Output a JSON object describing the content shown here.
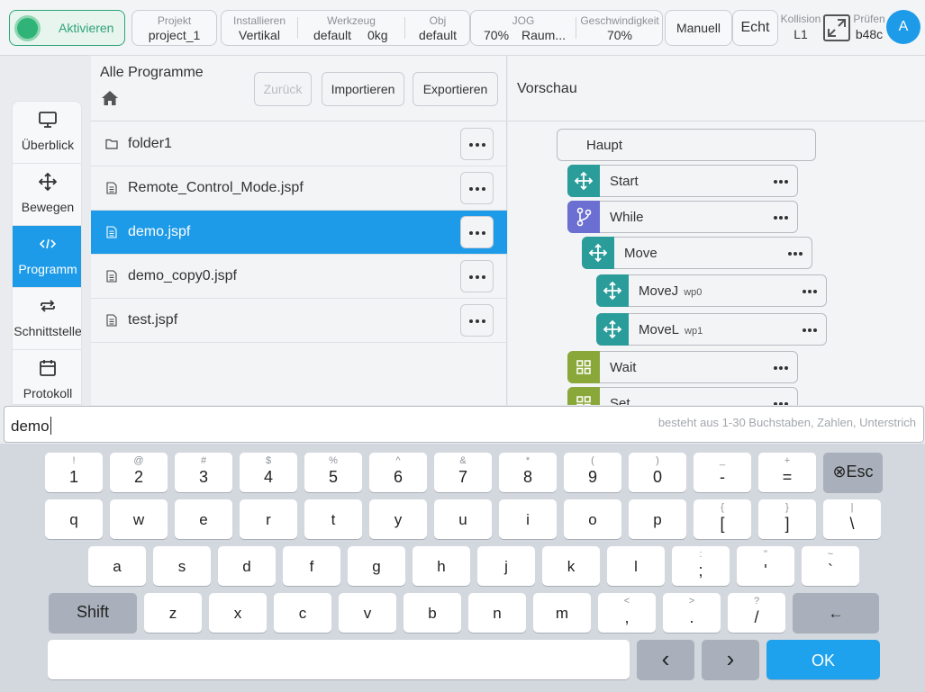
{
  "topbar": {
    "activate": "Aktivieren",
    "project": {
      "label": "Projekt",
      "value": "project_1"
    },
    "install": {
      "label": "Installieren",
      "value": "Vertikal"
    },
    "tool": {
      "label": "Werkzeug",
      "value": "default",
      "weight": "0kg"
    },
    "obj": {
      "label": "Obj",
      "value": "default"
    },
    "jog": {
      "label": "JOG",
      "value": "70%",
      "extra": "Raum..."
    },
    "speed": {
      "label": "Geschwindigkeit",
      "value": "70%"
    },
    "manual": "Manuell",
    "real": "Echt",
    "collision": {
      "label": "Kollision",
      "value": "L1"
    },
    "check": {
      "label": "Prüfen",
      "value": "b48c"
    },
    "avatar": "A"
  },
  "nav": {
    "items": [
      {
        "label": "Überblick",
        "icon": "monitor-icon"
      },
      {
        "label": "Bewegen",
        "icon": "move-icon"
      },
      {
        "label": "Programm",
        "icon": "code-icon",
        "active": true
      },
      {
        "label": "Schnittstelle",
        "icon": "swap-icon"
      },
      {
        "label": "Protokoll",
        "icon": "calendar-icon"
      }
    ]
  },
  "files": {
    "title": "Alle Programme",
    "back": "Zurück",
    "import": "Importieren",
    "export": "Exportieren",
    "rows": [
      {
        "name": "folder1",
        "type": "folder"
      },
      {
        "name": "Remote_Control_Mode.jspf",
        "type": "file"
      },
      {
        "name": "demo.jspf",
        "type": "file",
        "selected": true
      },
      {
        "name": "demo_copy0.jspf",
        "type": "file"
      },
      {
        "name": "test.jspf",
        "type": "file"
      }
    ]
  },
  "preview": {
    "title": "Vorschau",
    "root": "Haupt",
    "nodes": [
      {
        "label": "Start",
        "sub": "",
        "color": "#2a9c9a",
        "icon": "move-icon"
      },
      {
        "label": "While",
        "sub": "",
        "color": "#6b6fd1",
        "icon": "branch-icon"
      },
      {
        "label": "Move",
        "sub": "",
        "color": "#2a9c9a",
        "icon": "move-icon"
      },
      {
        "label": "MoveJ",
        "sub": "wp0",
        "color": "#2a9c9a",
        "icon": "move-icon"
      },
      {
        "label": "MoveL",
        "sub": "wp1",
        "color": "#2a9c9a",
        "icon": "move-icon"
      },
      {
        "label": "Wait",
        "sub": "",
        "color": "#8aa83a",
        "icon": "grid-icon"
      },
      {
        "label": "Set",
        "sub": "",
        "color": "#8aa83a",
        "icon": "grid-icon"
      }
    ]
  },
  "input": {
    "value": "demo",
    "hint": "besteht aus 1-30 Buchstaben, Zahlen, Unterstrich"
  },
  "keyboard": {
    "row1": [
      {
        "s": "!",
        "m": "1"
      },
      {
        "s": "@",
        "m": "2"
      },
      {
        "s": "#",
        "m": "3"
      },
      {
        "s": "$",
        "m": "4"
      },
      {
        "s": "%",
        "m": "5"
      },
      {
        "s": "^",
        "m": "6"
      },
      {
        "s": "&",
        "m": "7"
      },
      {
        "s": "*",
        "m": "8"
      },
      {
        "s": "(",
        "m": "9"
      },
      {
        "s": ")",
        "m": "0"
      },
      {
        "s": "_",
        "m": "-"
      },
      {
        "s": "+",
        "m": "="
      }
    ],
    "esc": "⊗Esc",
    "row2": [
      {
        "s": "",
        "m": "q"
      },
      {
        "s": "",
        "m": "w"
      },
      {
        "s": "",
        "m": "e"
      },
      {
        "s": "",
        "m": "r"
      },
      {
        "s": "",
        "m": "t"
      },
      {
        "s": "",
        "m": "y"
      },
      {
        "s": "",
        "m": "u"
      },
      {
        "s": "",
        "m": "i"
      },
      {
        "s": "",
        "m": "o"
      },
      {
        "s": "",
        "m": "p"
      },
      {
        "s": "{",
        "m": "["
      },
      {
        "s": "}",
        "m": "]"
      },
      {
        "s": "|",
        "m": "\\"
      }
    ],
    "row3": [
      {
        "s": "",
        "m": "a"
      },
      {
        "s": "",
        "m": "s"
      },
      {
        "s": "",
        "m": "d"
      },
      {
        "s": "",
        "m": "f"
      },
      {
        "s": "",
        "m": "g"
      },
      {
        "s": "",
        "m": "h"
      },
      {
        "s": "",
        "m": "j"
      },
      {
        "s": "",
        "m": "k"
      },
      {
        "s": "",
        "m": "l"
      },
      {
        "s": ":",
        "m": ";"
      },
      {
        "s": "\"",
        "m": "'"
      },
      {
        "s": "~",
        "m": "`"
      }
    ],
    "shift": "Shift",
    "row4": [
      {
        "s": "",
        "m": "z"
      },
      {
        "s": "",
        "m": "x"
      },
      {
        "s": "",
        "m": "c"
      },
      {
        "s": "",
        "m": "v"
      },
      {
        "s": "",
        "m": "b"
      },
      {
        "s": "",
        "m": "n"
      },
      {
        "s": "",
        "m": "m"
      },
      {
        "s": "<",
        "m": ","
      },
      {
        "s": ">",
        "m": "."
      },
      {
        "s": "?",
        "m": "/"
      }
    ],
    "backspace": "←",
    "left": "‹",
    "right": "›",
    "ok": "OK"
  }
}
